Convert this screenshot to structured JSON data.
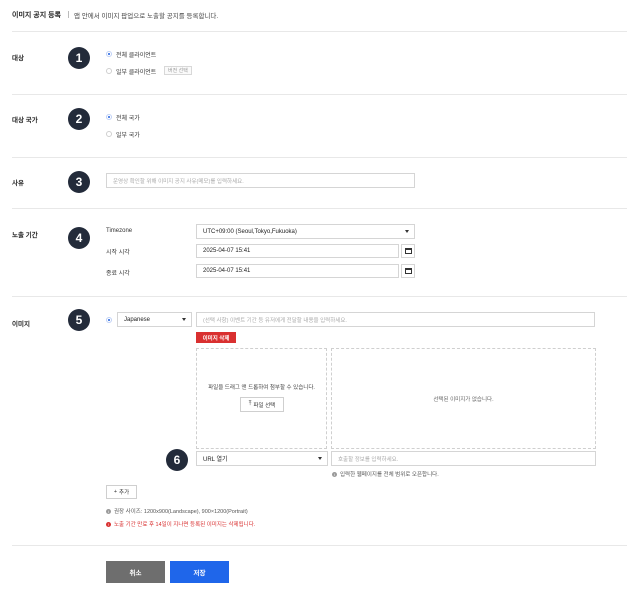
{
  "header": {
    "title": "이미지 공지 등록",
    "description": "앱 안에서 이미지 팝업으로 노출할 공지를 등록합니다."
  },
  "sections": {
    "target": {
      "label": "대상",
      "number": "1",
      "options": [
        {
          "label": "전체 클라이언트",
          "selected": true
        },
        {
          "label": "일부 클라이언트",
          "selected": false
        }
      ],
      "version_chip": "버전 선택"
    },
    "country": {
      "label": "대상 국가",
      "number": "2",
      "options": [
        {
          "label": "전체 국가",
          "selected": true
        },
        {
          "label": "일부 국가",
          "selected": false
        }
      ]
    },
    "reason": {
      "label": "사유",
      "number": "3",
      "placeholder": "운영상 확인할 위해 이미지 공지 사유(메모)를 입력하세요."
    },
    "period": {
      "label": "노출 기간",
      "number": "4",
      "timezone_label": "Timezone",
      "timezone_value": "UTC+09:00 (Seoul,Tokyo,Fukuoka)",
      "start_label": "시작 시각",
      "start_value": "2025-04-07 15:41",
      "end_label": "종료 시각",
      "end_value": "2025-04-07 15:41"
    },
    "image": {
      "label": "이미지",
      "number": "5",
      "language": "Japanese",
      "text_placeholder": "(선택 사항) 이벤트 기간 등 유저에게 전달할 내용을 입력하세요.",
      "delete_button": "이미지 삭제",
      "dropzone_text": "파일을 드래그 앤 드롭하여 첨부할 수 있습니다.",
      "file_button": "파일 선택",
      "preview_text": "선택된 이미지가 없습니다.",
      "number6": "6",
      "link_type": "URL 열기",
      "link_placeholder": "호출할 정보를 입력하세요.",
      "link_note": "입력한 웹페이지를 전체 범위로 오픈합니다.",
      "add_button": "추가",
      "size_note": "권장 사이즈: 1200x900(Landscape), 900×1200(Portrait)",
      "warning_note": "노출 기간 만료 후 14일이 지나면 등록된 이미지는 삭제됩니다."
    }
  },
  "footer": {
    "cancel": "취소",
    "save": "저장"
  },
  "colors": {
    "primary": "#1f66ea",
    "danger": "#d93030",
    "badge": "#232b3a",
    "cancel": "#6e6e6e"
  }
}
